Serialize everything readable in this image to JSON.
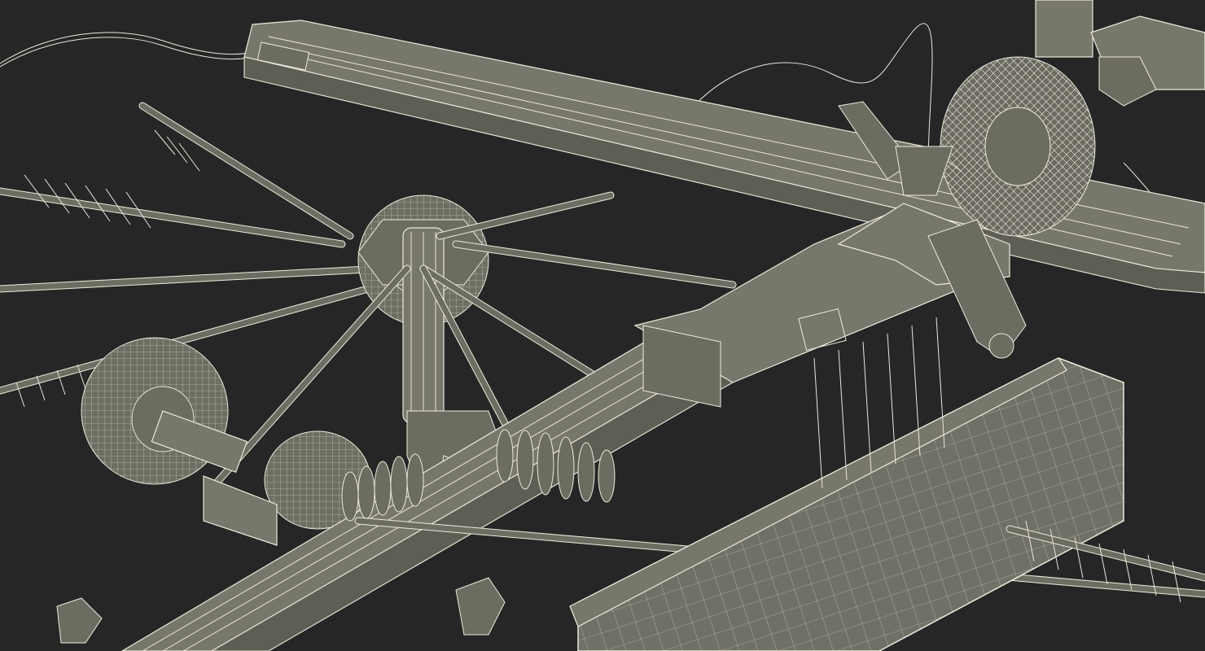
{
  "scene": {
    "subject": "wireframe-render",
    "background_color": "#262626",
    "wire_color": "#ecebdd",
    "surface_color": "#77776b"
  }
}
